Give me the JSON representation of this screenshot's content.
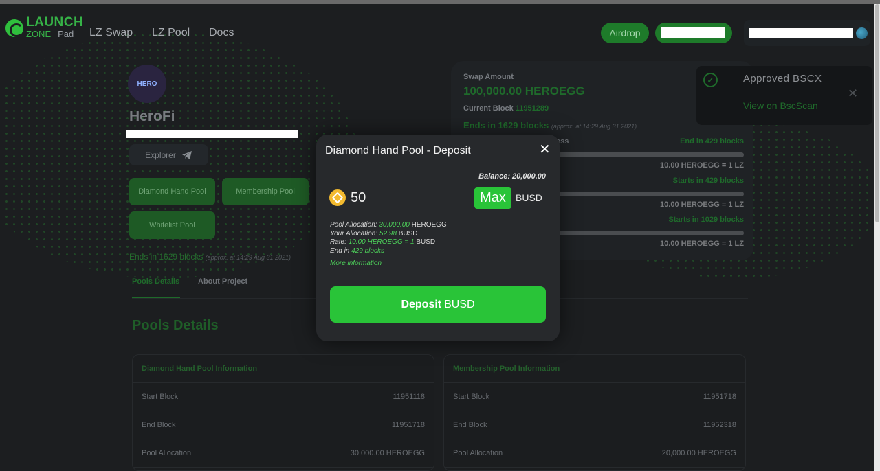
{
  "header": {
    "logo": {
      "line1": "LAUNCH",
      "line2": "ZONE",
      "line3": "Pad"
    },
    "nav": [
      "LZ Swap",
      "LZ Pool",
      "Docs"
    ],
    "airdrop_label": "Airdrop"
  },
  "project": {
    "name": "HeroFi",
    "avatar_text": "HERO",
    "explorer_label": "Explorer",
    "pools": [
      "Diamond Hand Pool",
      "Membership Pool",
      "Whitelist Pool"
    ],
    "ends": "Ends in 1629 blocks",
    "ends_note": "(approx. at 14:29 Aug 31 2021)",
    "tabs": [
      "Pools Details",
      "About Project"
    ],
    "section_title": "Pools Details"
  },
  "info_tables": [
    {
      "title": "Diamond Hand Pool Information",
      "rows": [
        {
          "label": "Start Block",
          "value": "11951118"
        },
        {
          "label": "End Block",
          "value": "11951718"
        },
        {
          "label": "Pool Allocation",
          "value": "30,000.00 HEROEGG"
        }
      ]
    },
    {
      "title": "Membership Pool Information",
      "rows": [
        {
          "label": "Start Block",
          "value": "11951718"
        },
        {
          "label": "End Block",
          "value": "11952318"
        },
        {
          "label": "Pool Allocation",
          "value": "20,000.00 HEROEGG"
        }
      ]
    }
  ],
  "swap": {
    "label": "Swap Amount",
    "amount": "100,000.00 HEROEGG",
    "current_block_label": "Current Block",
    "current_block": "11951289",
    "ends": "Ends in 1629 blocks",
    "ends_note": "(approx. at 14:29 Aug 31 2021)",
    "pools": [
      {
        "name": "ess",
        "status": "End in 429 blocks",
        "rate": "10.00 HEROEGG = 1 LZ"
      },
      {
        "name": "s",
        "status": "Starts in 429 blocks",
        "rate": "10.00 HEROEGG = 1 LZ"
      },
      {
        "name": "",
        "status": "Starts in 1029 blocks",
        "rate": "10.00 HEROEGG = 1 LZ"
      }
    ]
  },
  "toast": {
    "title": "Approved BSCX",
    "link": "View on BscScan"
  },
  "modal": {
    "title": "Diamond Hand Pool - Deposit",
    "balance": "Balance: 20,000.00",
    "amount": "50",
    "max_label": "Max",
    "currency": "BUSD",
    "details": {
      "pool_allocation_label": "Pool Allocation:",
      "pool_allocation_value": "30,000.00",
      "pool_allocation_unit": "HEROEGG",
      "your_allocation_label": "Your Allocation:",
      "your_allocation_value": "52.98",
      "your_allocation_unit": "BUSD",
      "rate_label": "Rate:",
      "rate_value": "10.00 HEROEGG = 1",
      "rate_unit": "BUSD",
      "end_label": "End in",
      "end_value": "429 blocks"
    },
    "more_info": "More information",
    "deposit_label": "Deposit",
    "deposit_currency": "BUSD"
  },
  "colors": {
    "accent": "#29c438",
    "background": "#1c1e20",
    "modal": "#27292c"
  }
}
